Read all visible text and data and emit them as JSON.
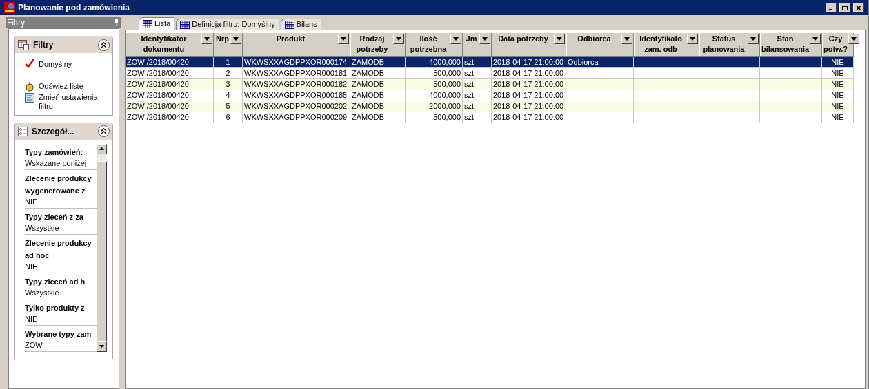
{
  "window": {
    "title": "Planowanie pod zamówienia"
  },
  "filter_pane": {
    "title": "Filtry",
    "filters_section": {
      "title": "Filtry",
      "filters": [
        {
          "label": "Domyślny",
          "selected": true
        }
      ],
      "actions": [
        "Odśwież listę",
        "Zmień ustawienia filtru"
      ]
    },
    "details_section": {
      "title": "Szczegół...",
      "fields": [
        {
          "label": "Typy zamówień:",
          "value": "Wskazane poniżej"
        },
        {
          "label": "Zlecenie produkcy\nwygenerowane z",
          "value": "NIE"
        },
        {
          "label": "Typy zleceń z za",
          "value": "Wszystkie"
        },
        {
          "label": "Zlecenie produkcy\nad hoc",
          "value": "NIE"
        },
        {
          "label": "Typy zleceń ad h",
          "value": "Wszystkie"
        },
        {
          "label": "Tylko produkty z",
          "value": "NIE"
        },
        {
          "label": "Wybrane typy zam",
          "value": "ZOW"
        }
      ]
    }
  },
  "tabs": [
    {
      "label": "Lista",
      "selected": true
    },
    {
      "label": "Definicja filtru: Domyślny",
      "selected": false
    },
    {
      "label": "Bilans",
      "selected": false
    }
  ],
  "table": {
    "columns": [
      {
        "label": "Identyfikator\ndokumentu"
      },
      {
        "label": "Nrp"
      },
      {
        "label": "Produkt"
      },
      {
        "label": "Rodzaj\npotrzeby"
      },
      {
        "label": "Ilość\npotrzebna"
      },
      {
        "label": "Jm"
      },
      {
        "label": "Data potrzeby"
      },
      {
        "label": "Odbiorca"
      },
      {
        "label": "Identyfikato\nzam. odb"
      },
      {
        "label": "Status\nplanowania"
      },
      {
        "label": "Stan\nbilansowania"
      },
      {
        "label": "Czy\npotw.?"
      }
    ],
    "rows": [
      {
        "selected": true,
        "cells": [
          "ZOW /2018/00420",
          "1",
          "WKWSXXAGDPPXOR000174",
          "ZAMODB",
          "4000,000",
          "szt",
          "2018-04-17 21:00:00",
          "Odbiorca",
          "",
          "",
          "",
          "NIE"
        ]
      },
      {
        "selected": false,
        "cells": [
          "ZOW /2018/00420",
          "2",
          "WKWSXXAGDPPXOR000181",
          "ZAMODB",
          "500,000",
          "szt",
          "2018-04-17 21:00:00",
          "",
          "",
          "",
          "",
          "NIE"
        ]
      },
      {
        "selected": false,
        "cells": [
          "ZOW /2018/00420",
          "3",
          "WKWSXXAGDPPXOR000182",
          "ZAMODB",
          "500,000",
          "szt",
          "2018-04-17 21:00:00",
          "",
          "",
          "",
          "",
          "NIE"
        ]
      },
      {
        "selected": false,
        "cells": [
          "ZOW /2018/00420",
          "4",
          "WKWSXXAGDPPXOR000185",
          "ZAMODB",
          "4000,000",
          "szt",
          "2018-04-17 21:00:00",
          "",
          "",
          "",
          "",
          "NIE"
        ]
      },
      {
        "selected": false,
        "cells": [
          "ZOW /2018/00420",
          "5",
          "WKWSXXAGDPPXOR000202",
          "ZAMODB",
          "2000,000",
          "szt",
          "2018-04-17 21:00:00",
          "",
          "",
          "",
          "",
          "NIE"
        ]
      },
      {
        "selected": false,
        "cells": [
          "ZOW /2018/00420",
          "6",
          "WKWSXXAGDPPXOR000209",
          "ZAMODB",
          "500,000",
          "szt",
          "2018-04-17 21:00:00",
          "",
          "",
          "",
          "",
          "NIE"
        ]
      }
    ]
  }
}
